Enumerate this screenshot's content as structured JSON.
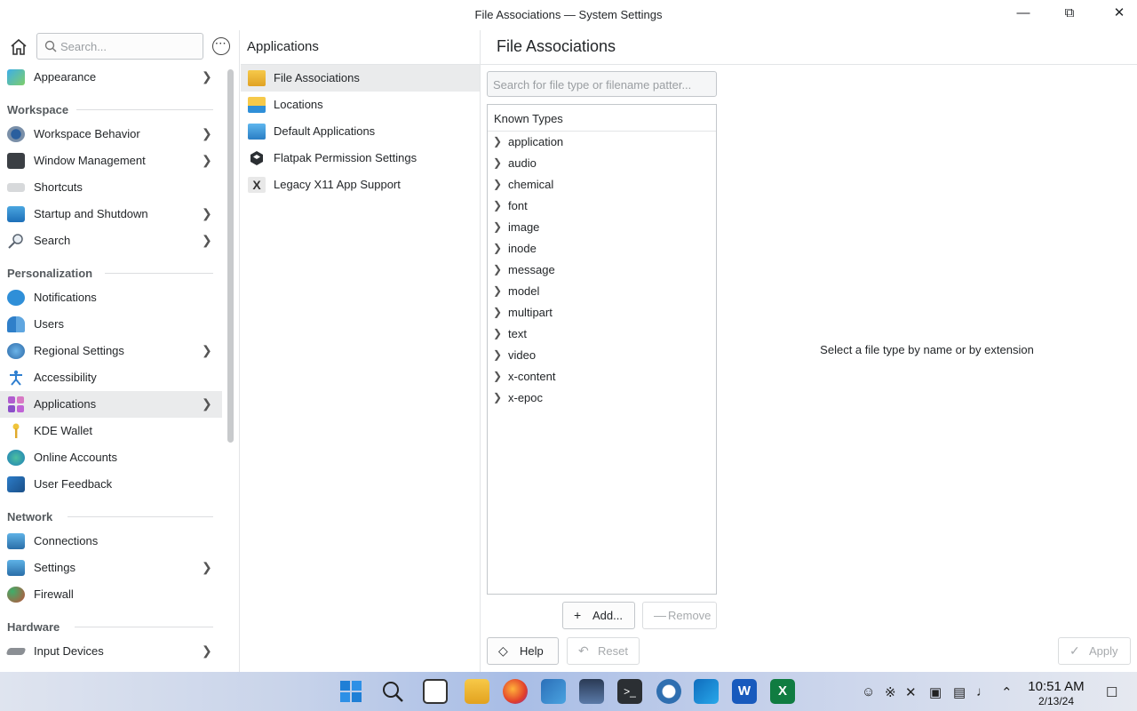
{
  "window": {
    "title": "File Associations — System Settings"
  },
  "sidebar": {
    "search_placeholder": "Search...",
    "sections": {
      "workspace": "Workspace",
      "personalization": "Personalization",
      "network": "Network",
      "hardware": "Hardware"
    },
    "items": [
      {
        "label": "Appearance"
      },
      {
        "label": "Workspace Behavior"
      },
      {
        "label": "Window Management"
      },
      {
        "label": "Shortcuts"
      },
      {
        "label": "Startup and Shutdown"
      },
      {
        "label": "Search"
      },
      {
        "label": "Notifications"
      },
      {
        "label": "Users"
      },
      {
        "label": "Regional Settings"
      },
      {
        "label": "Accessibility"
      },
      {
        "label": "Applications"
      },
      {
        "label": "KDE Wallet"
      },
      {
        "label": "Online Accounts"
      },
      {
        "label": "User Feedback"
      },
      {
        "label": "Connections"
      },
      {
        "label": "Settings"
      },
      {
        "label": "Firewall"
      },
      {
        "label": "Input Devices"
      }
    ]
  },
  "middle": {
    "title": "Applications",
    "items": [
      {
        "label": "File Associations"
      },
      {
        "label": "Locations"
      },
      {
        "label": "Default Applications"
      },
      {
        "label": "Flatpak Permission Settings"
      },
      {
        "label": "Legacy X11 App Support"
      }
    ]
  },
  "main": {
    "title": "File Associations",
    "search_placeholder": "Search for file type or filename patter...",
    "tree_header": "Known Types",
    "types": [
      "application",
      "audio",
      "chemical",
      "font",
      "image",
      "inode",
      "message",
      "model",
      "multipart",
      "text",
      "video",
      "x-content",
      "x-epoc"
    ],
    "empty_message": "Select a file type by name or by extension",
    "buttons": {
      "add": "Add...",
      "remove": "Remove",
      "help": "Help",
      "reset": "Reset",
      "apply": "Apply"
    }
  },
  "taskbar": {
    "time": "10:51 AM",
    "date": "2/13/24"
  }
}
